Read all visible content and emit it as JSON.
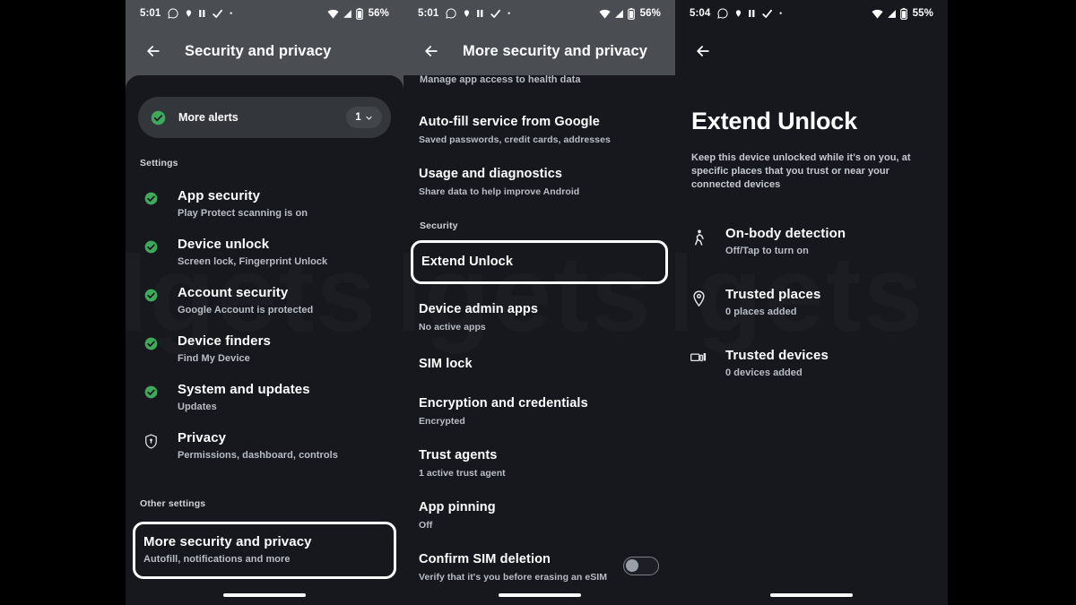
{
  "theme": {
    "page_background": "#000000",
    "panel_background": "#16181d",
    "app_bar_background": "#4a4d52",
    "accent_green": "#3ea95a",
    "primary_text": "#ffffff",
    "secondary_text": "#b9bdc4",
    "highlight_outline": "#ffffff"
  },
  "watermark": {
    "text": "Gadgets 360"
  },
  "panels": [
    {
      "id": "security-and-privacy",
      "status_bar": {
        "time": "5:01",
        "left_icons": [
          "whatsapp-icon",
          "location-icon",
          "pause-icon",
          "check-icon",
          "dot-icon"
        ],
        "right_icons": [
          "wifi-icon",
          "signal-icon",
          "battery-icon"
        ],
        "battery_percent": "56%"
      },
      "app_bar": {
        "back": "back-arrow-icon",
        "title": "Security and privacy"
      },
      "alert_chip": {
        "icon": "check-circle-icon",
        "label": "More alerts",
        "count": "1",
        "chevron": "chevron-down-icon"
      },
      "section_label": "Settings",
      "rows": [
        {
          "icon": "check-circle-icon",
          "title": "App security",
          "sub": "Play Protect scanning is on"
        },
        {
          "icon": "check-circle-icon",
          "title": "Device unlock",
          "sub": "Screen lock, Fingerprint Unlock"
        },
        {
          "icon": "check-circle-icon",
          "title": "Account security",
          "sub": "Google Account is protected"
        },
        {
          "icon": "check-circle-icon",
          "title": "Device finders",
          "sub": "Find My Device"
        },
        {
          "icon": "check-circle-icon",
          "title": "System and updates",
          "sub": "Updates"
        },
        {
          "icon": "shield-lock-icon",
          "title": "Privacy",
          "sub": "Permissions, dashboard, controls"
        }
      ],
      "other_section_label": "Other settings",
      "highlighted_row": {
        "title": "More security and privacy",
        "sub": "Autofill, notifications and more"
      },
      "nav_pill": "gesture-nav-pill"
    },
    {
      "id": "more-security-and-privacy",
      "status_bar": {
        "time": "5:01",
        "left_icons": [
          "whatsapp-icon",
          "location-icon",
          "pause-icon",
          "check-icon",
          "dot-icon"
        ],
        "right_icons": [
          "wifi-icon",
          "signal-icon",
          "battery-icon"
        ],
        "battery_percent": "56%"
      },
      "app_bar": {
        "back": "back-arrow-icon",
        "title": "More security and privacy"
      },
      "clipped_row_sub": "Manage app access to health data",
      "rows_top": [
        {
          "title": "Auto-fill service from Google",
          "sub": "Saved passwords, credit cards, addresses"
        },
        {
          "title": "Usage and diagnostics",
          "sub": "Share data to help improve Android"
        }
      ],
      "section_label": "Security",
      "highlighted_row": {
        "title": "Extend Unlock"
      },
      "rows_bottom": [
        {
          "title": "Device admin apps",
          "sub": "No active apps"
        },
        {
          "title": "SIM lock",
          "sub": ""
        },
        {
          "title": "Encryption and credentials",
          "sub": "Encrypted"
        },
        {
          "title": "Trust agents",
          "sub": "1 active trust agent"
        },
        {
          "title": "App pinning",
          "sub": "Off"
        }
      ],
      "toggle_row": {
        "title": "Confirm SIM deletion",
        "sub": "Verify that it's you before erasing an eSIM",
        "state": "off"
      },
      "nav_pill": "gesture-nav-pill"
    },
    {
      "id": "extend-unlock",
      "status_bar": {
        "time": "5:04",
        "left_icons": [
          "whatsapp-icon",
          "location-icon",
          "pause-icon",
          "check-icon",
          "dot-icon"
        ],
        "right_icons": [
          "wifi-icon",
          "signal-icon",
          "battery-icon"
        ],
        "battery_percent": "55%"
      },
      "app_bar": {
        "back": "back-arrow-icon",
        "title": ""
      },
      "hero": {
        "title": "Extend Unlock",
        "description": "Keep this device unlocked while it's on you, at specific places that you trust or near your connected devices"
      },
      "rows": [
        {
          "icon": "walking-person-icon",
          "title": "On-body detection",
          "sub": "Off/Tap to turn on"
        },
        {
          "icon": "map-pin-icon",
          "title": "Trusted places",
          "sub": "0 places added"
        },
        {
          "icon": "devices-icon",
          "title": "Trusted devices",
          "sub": "0 devices added"
        }
      ],
      "nav_pill": "gesture-nav-pill"
    }
  ]
}
